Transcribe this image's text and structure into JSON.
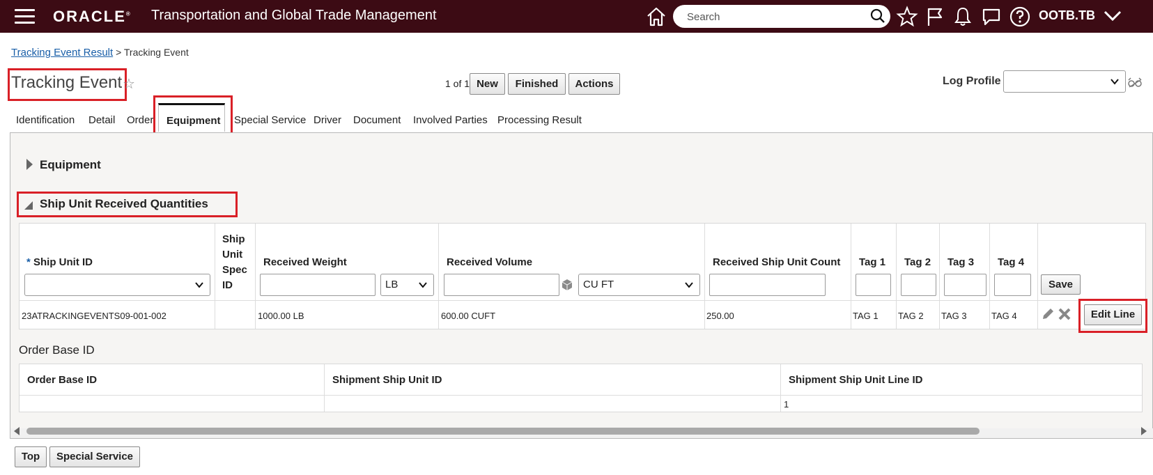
{
  "topbar": {
    "logo": "ORACLE",
    "title": "Transportation and Global Trade Management",
    "search_placeholder": "Search",
    "user": "OOTB.TB",
    "icons": [
      "menu-icon",
      "home-icon",
      "search-icon",
      "star-icon",
      "flag-icon",
      "bell-icon",
      "chat-icon",
      "help-icon",
      "chevron-down-icon"
    ]
  },
  "breadcrumb": {
    "link": "Tracking Event Result",
    "separator": ">",
    "current": "Tracking Event"
  },
  "header": {
    "title": "Tracking Event",
    "pager": "1 of 1",
    "buttons": {
      "new": "New",
      "finished": "Finished",
      "actions": "Actions"
    },
    "log_profile_label": "Log Profile",
    "log_profile_value": ""
  },
  "tabs": [
    "Identification",
    "Detail",
    "Order",
    "Equipment",
    "Special Service",
    "Driver",
    "Document",
    "Involved Parties",
    "Processing Result"
  ],
  "active_tab": "Equipment",
  "sections": {
    "equipment": "Equipment",
    "ship_unit": "Ship Unit Received Quantities",
    "order_base": "Order Base ID"
  },
  "ship_unit_table": {
    "headers": {
      "ship_unit_id": "Ship Unit ID",
      "required_mark": "*",
      "spec_id": [
        "Ship",
        "Unit",
        "Spec",
        "ID"
      ],
      "received_weight": "Received Weight",
      "received_volume": "Received Volume",
      "received_count": "Received Ship Unit Count",
      "tag1": "Tag 1",
      "tag2": "Tag 2",
      "tag3": "Tag 3",
      "tag4": "Tag 4"
    },
    "inputs": {
      "weight_uom": "LB",
      "volume_uom": "CU FT",
      "save": "Save"
    },
    "row": {
      "ship_unit_id": "23ATRACKINGEVENTS09-001-002",
      "spec_id": "",
      "received_weight": "1000.00 LB",
      "received_volume": "600.00 CUFT",
      "received_count": "250.00",
      "tag1": "TAG 1",
      "tag2": "TAG 2",
      "tag3": "TAG 3",
      "tag4": "TAG 4",
      "edit_line": "Edit Line"
    }
  },
  "order_table": {
    "headers": [
      "Order Base ID",
      "Shipment Ship Unit ID",
      "Shipment Ship Unit Line ID"
    ],
    "row": [
      "",
      "",
      "1"
    ]
  },
  "footer_buttons": {
    "top": "Top",
    "special_service": "Special Service"
  },
  "colors": {
    "topbar": "#3c0b14",
    "highlight": "#d92027",
    "link": "#1a5fa8"
  }
}
